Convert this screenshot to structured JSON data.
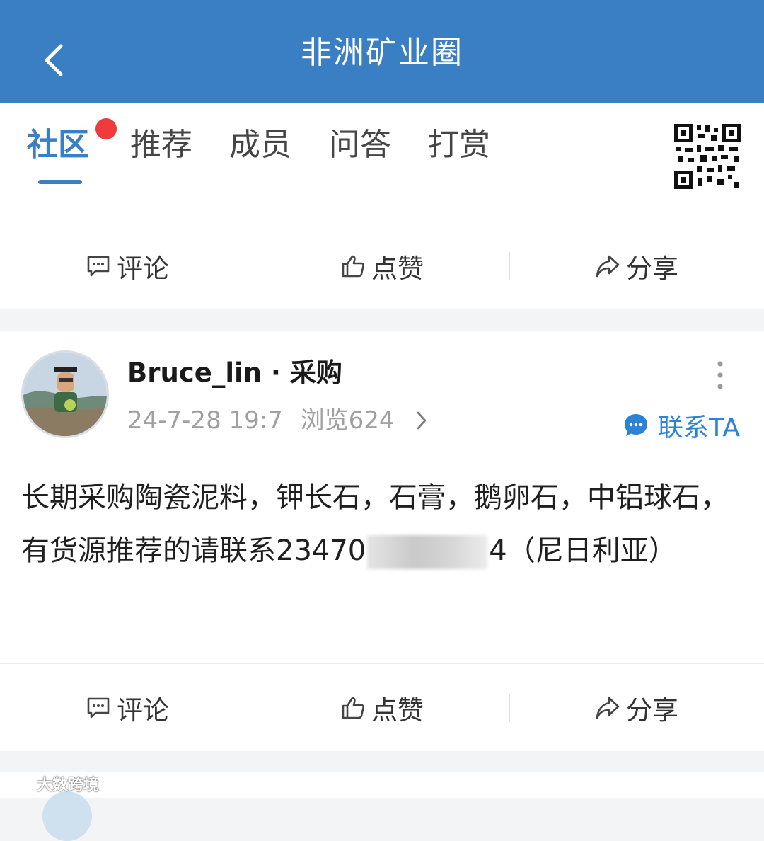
{
  "header": {
    "title": "非洲矿业圈",
    "back_icon": "chevron-left-icon",
    "background": "#3a7fc3"
  },
  "tabs": [
    {
      "label": "社区",
      "active": true,
      "has_badge": true
    },
    {
      "label": "推荐",
      "active": false
    },
    {
      "label": "成员",
      "active": false
    },
    {
      "label": "问答",
      "active": false
    },
    {
      "label": "打赏",
      "active": false
    }
  ],
  "qr_icon": "qr-code-icon",
  "top_actions": {
    "comment": "评论",
    "like": "点赞",
    "share": "分享"
  },
  "post": {
    "author": "Bruce_lin",
    "role": "· 采购",
    "date": "24-7-28 19:7",
    "views": "浏览624",
    "contact_label": "联系TA",
    "content_before": "长期采购陶瓷泥料，钾长石，石膏，鹅卵石，中铝球石，有货源推荐的请联系23470",
    "content_after": "4（尼日利亚）",
    "actions": {
      "comment": "评论",
      "like": "点赞",
      "share": "分享"
    }
  },
  "watermark": "大数跨境",
  "colors": {
    "accent": "#3a7fc3",
    "badge": "#ef3b3b",
    "link": "#2c82d6"
  }
}
